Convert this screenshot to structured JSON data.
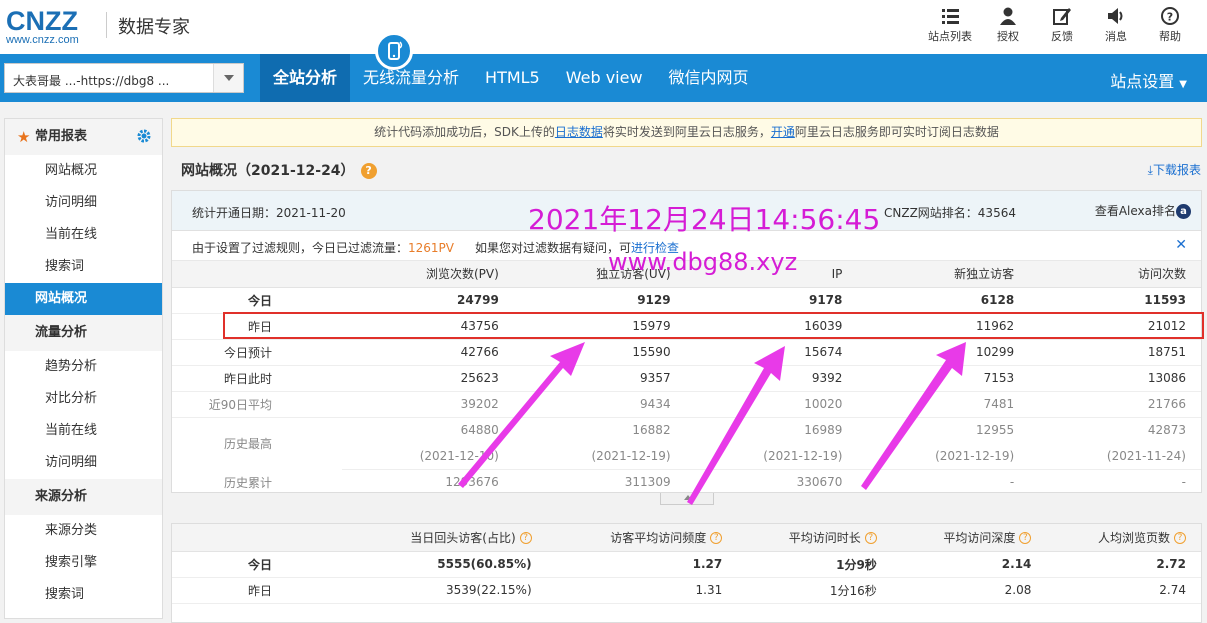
{
  "header": {
    "logo_text": "CNZZ",
    "logo_url": "www.cnzz.com",
    "product_name": "数据专家",
    "icons": [
      {
        "name": "list-icon",
        "label": "站点列表"
      },
      {
        "name": "user-icon",
        "label": "授权"
      },
      {
        "name": "edit-icon",
        "label": "反馈"
      },
      {
        "name": "speaker-icon",
        "label": "消息"
      },
      {
        "name": "help-icon",
        "label": "帮助"
      }
    ]
  },
  "nav": {
    "site_selector": "大表哥最 ...-https://dbg8 ...",
    "tabs": [
      "全站分析",
      "无线流量分析",
      "HTML5",
      "Web view",
      "微信内网页"
    ],
    "active_tab": "全站分析",
    "settings_label": "站点设置"
  },
  "sidebar": {
    "sections": [
      {
        "title": "常用报表",
        "items": [
          "网站概况",
          "访问明细",
          "当前在线",
          "搜索词"
        ]
      },
      {
        "title": "网站概况",
        "active": true,
        "items": []
      },
      {
        "title": "流量分析",
        "items": [
          "趋势分析",
          "对比分析",
          "当前在线",
          "访问明细"
        ]
      },
      {
        "title": "来源分析",
        "items": [
          "来源分类",
          "搜索引擎",
          "搜索词"
        ]
      }
    ]
  },
  "notice": {
    "part1": "统计代码添加成功后，SDK上传的",
    "link1": "日志数据",
    "part2": "将实时发送到阿里云日志服务，",
    "link2": "开通",
    "part3": "阿里云日志服务即可实时订阅日志数据"
  },
  "overview": {
    "title": "网站概况（2021-12-24）",
    "download_label": "下载报表",
    "open_date": "统计开通日期：2021-11-20",
    "rank": "CNZZ网站排名：43564",
    "alexa_label": "查看Alexa排名",
    "filter_text": "由于设置了过滤规则，今日已过滤流量：",
    "filter_value": "1261PV",
    "doubt_text": "如果您对过滤数据有疑问，可",
    "doubt_link": "进行检查",
    "columns": [
      "浏览次数(PV)",
      "独立访客(UV)",
      "IP",
      "新独立访客",
      "访问次数"
    ],
    "rows": [
      {
        "label": "今日",
        "values": [
          "24799",
          "9129",
          "9178",
          "6128",
          "11593"
        ]
      },
      {
        "label": "昨日",
        "values": [
          "43756",
          "15979",
          "16039",
          "11962",
          "21012"
        ]
      },
      {
        "label": "今日预计",
        "values": [
          "42766",
          "15590",
          "15674",
          "10299",
          "18751"
        ]
      },
      {
        "label": "昨日此时",
        "values": [
          "25623",
          "9357",
          "9392",
          "7153",
          "13086"
        ]
      },
      {
        "label": "近90日平均",
        "values": [
          "39202",
          "9434",
          "10020",
          "7481",
          "21766"
        ]
      },
      {
        "label": "历史最高",
        "values": [
          "64880",
          "16882",
          "16989",
          "12955",
          "42873"
        ]
      },
      {
        "label": "",
        "values": [
          "(2021-12-10)",
          "(2021-12-19)",
          "(2021-12-19)",
          "(2021-12-19)",
          "(2021-11-24)"
        ]
      },
      {
        "label": "历史累计",
        "values": [
          "1293676",
          "311309",
          "330670",
          "-",
          "-"
        ]
      }
    ]
  },
  "second": {
    "columns": [
      "当日回头访客(占比)",
      "访客平均访问频度",
      "平均访问时长",
      "平均访问深度",
      "人均浏览页数"
    ],
    "rows": [
      {
        "label": "今日",
        "values": [
          "5555(60.85%)",
          "1.27",
          "1分9秒",
          "2.14",
          "2.72"
        ]
      },
      {
        "label": "昨日",
        "values": [
          "3539(22.15%)",
          "1.31",
          "1分16秒",
          "2.08",
          "2.74"
        ]
      }
    ]
  },
  "watermark": {
    "datetime": "2021年12月24日14:56:45",
    "site": "www.dbg88.xyz"
  },
  "colors": {
    "brand": "#1a8ad4",
    "highlight": "#e0302a",
    "annotation": "#d51cd5"
  }
}
